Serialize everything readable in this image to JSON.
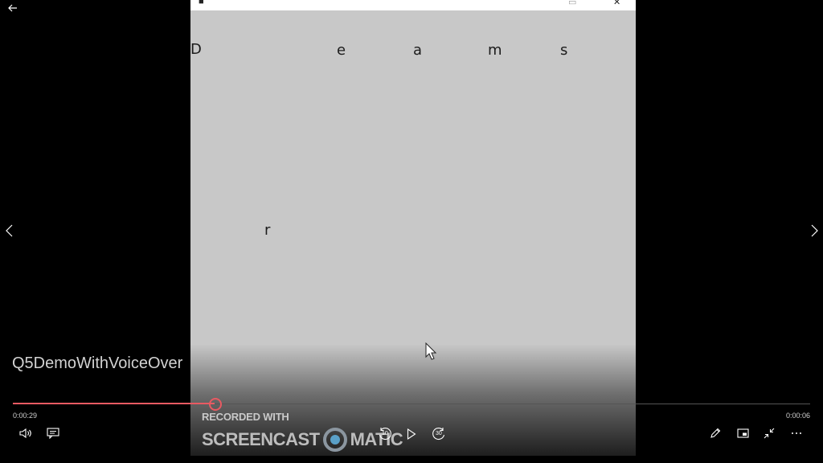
{
  "player": {
    "title": "Q5DemoWithVoiceOver",
    "current_time": "0:00:29",
    "total_time": "0:00:06",
    "progress": 0.253
  },
  "video": {
    "letters": [
      "D",
      "e",
      "a",
      "m",
      "s",
      "r"
    ]
  },
  "watermark": {
    "recorded_with": "RECORDED WITH",
    "brand_left": "SCREENCAST",
    "brand_right": "MATIC"
  },
  "controls": {
    "skip_back_seconds": "10",
    "skip_forward_seconds": "30"
  },
  "colors": {
    "accent": "#e85a62",
    "background": "#000000",
    "frame": "#c8c8c8"
  },
  "icons": [
    "back-arrow-icon",
    "prev-chevron-icon",
    "next-chevron-icon",
    "volume-icon",
    "captions-icon",
    "skip-back-icon",
    "play-icon",
    "skip-forward-icon",
    "edit-pen-icon",
    "mini-view-icon",
    "exit-fullscreen-icon",
    "more-icon"
  ]
}
